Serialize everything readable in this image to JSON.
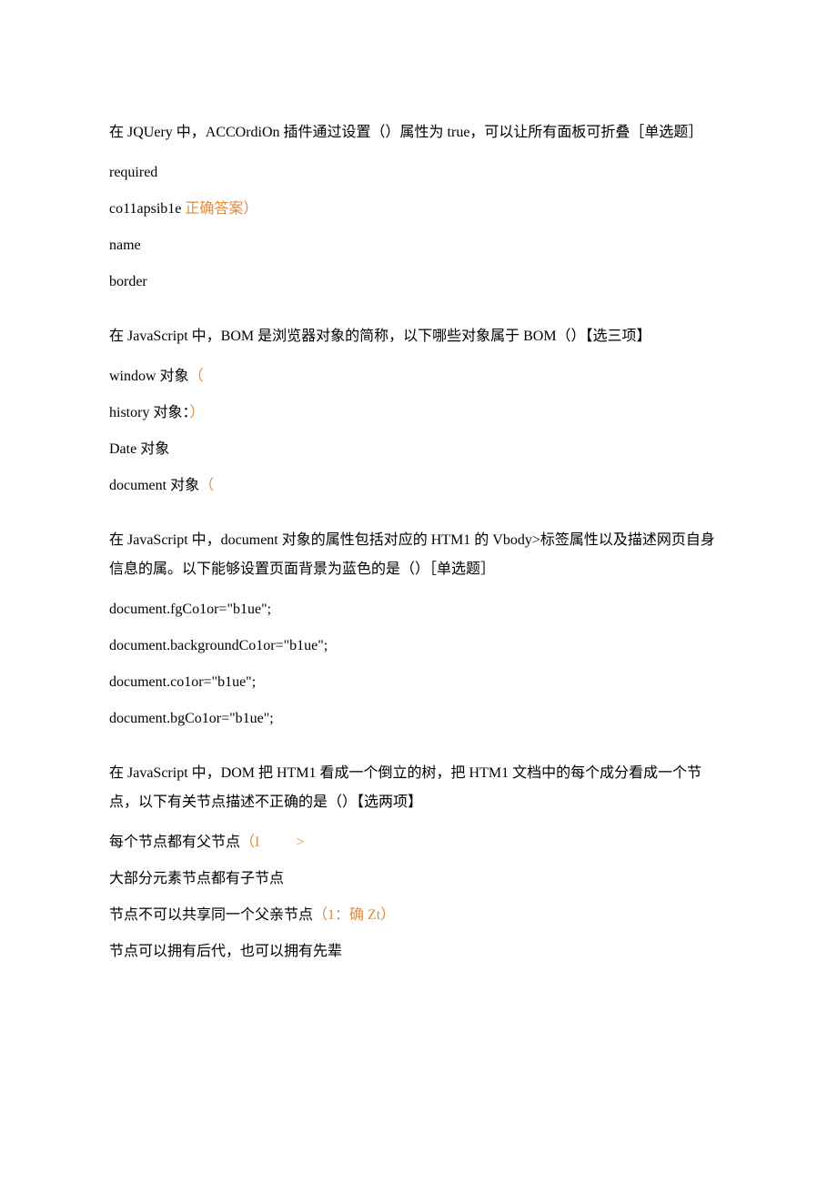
{
  "q1": {
    "text": "在 JQUery 中，ACCOrdiOn 插件通过设置（）属性为 true，可以让所有面板可折叠［单选题］",
    "optA": "required",
    "optB_pre": "co11apsib1e ",
    "optB_mark": "正确答案）",
    "optC": "name",
    "optD": "border"
  },
  "q2": {
    "text": "在 JavaScript 中，BOM 是浏览器对象的简称，以下哪些对象属于 BOM（）【选三项】",
    "optA_pre": "window 对象",
    "optA_mark": "（",
    "optB_pre": "history 对象：",
    "optB_mark": "）",
    "optC": "Date 对象",
    "optD_pre": "document 对象",
    "optD_mark": "（"
  },
  "q3": {
    "text": "在 JavaScript 中，document 对象的属性包括对应的 HTM1 的 Vbody>标签属性以及描述网页自身信息的属。以下能够设置页面背景为蓝色的是（）［单选题］",
    "optA": "document.fgCo1or=\"b1ue\";",
    "optB": "document.backgroundCo1or=\"b1ue\";",
    "optC": "document.co1or=\"b1ue\";",
    "optD": "document.bgCo1or=\"b1ue\";"
  },
  "q4": {
    "text": "在 JavaScript 中，DOM 把 HTM1 看成一个倒立的树，把 HTM1 文档中的每个成分看成一个节点，以下有关节点描述不正确的是（）【选两项】",
    "optA_pre": "每个节点都有父节点",
    "optA_mark": "（I          >",
    "optB": "大部分元素节点都有子节点",
    "optC_pre": "节点不可以共享同一个父亲节点",
    "optC_mark": "（1：确 Zt）",
    "optD": "节点可以拥有后代，也可以拥有先辈"
  }
}
